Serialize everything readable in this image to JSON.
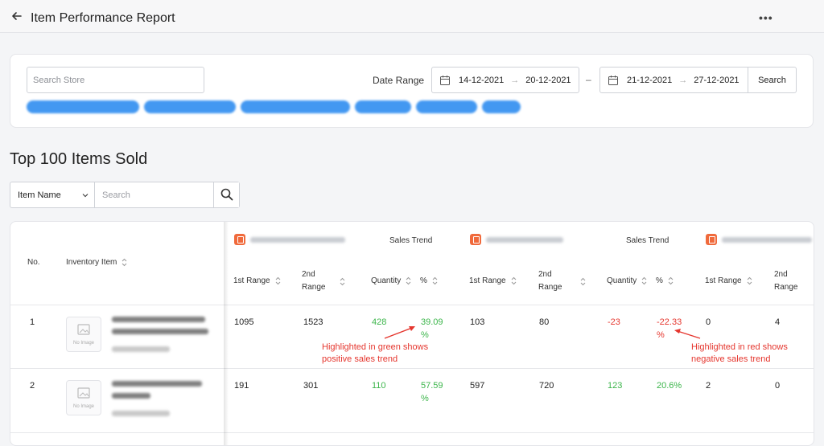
{
  "header": {
    "title": "Item Performance Report",
    "more": "•••"
  },
  "filters": {
    "search_store_placeholder": "Search Store",
    "date_range_label": "Date Range",
    "range1": {
      "start": "14-12-2021",
      "end": "20-12-2021"
    },
    "range2": {
      "start": "21-12-2021",
      "end": "27-12-2021"
    },
    "range_arrow": "→",
    "range_separator": "–",
    "search_button": "Search"
  },
  "section_title": "Top 100 Items Sold",
  "item_search": {
    "field": "Item Name",
    "placeholder": "Search"
  },
  "table": {
    "headers": {
      "no": "No.",
      "inventory_item": "Inventory Item",
      "sales_trend": "Sales Trend",
      "first_range": "1st Range",
      "second_range_line1": "2nd",
      "second_range_line2": "Range",
      "quantity": "Quantity",
      "percent": "%"
    },
    "no_image": "No Image",
    "rows": [
      {
        "no": "1",
        "store1": {
          "first": "1095",
          "second": "1523",
          "qty": "428",
          "pct_line1": "39.09",
          "pct_line2": "%"
        },
        "store2": {
          "first": "103",
          "second": "80",
          "qty": "-23",
          "pct_line1": "-22.33",
          "pct_line2": "%"
        },
        "store3": {
          "first": "0",
          "second": "4"
        }
      },
      {
        "no": "2",
        "store1": {
          "first": "191",
          "second": "301",
          "qty": "110",
          "pct_line1": "57.59",
          "pct_line2": "%"
        },
        "store2": {
          "first": "597",
          "second": "720",
          "qty": "123",
          "pct": "20.6%"
        },
        "store3": {
          "first": "2",
          "second": "0"
        }
      }
    ]
  },
  "annotations": {
    "green_line1": "Highlighted in green shows",
    "green_line2": "positive sales trend",
    "red_line1": "Highlighted in red shows",
    "red_line2": "negative sales trend"
  },
  "colors": {
    "positive": "#3bb54a",
    "negative": "#e5362e",
    "tag": "#2f8df0",
    "store_icon": "#f06a3c"
  }
}
